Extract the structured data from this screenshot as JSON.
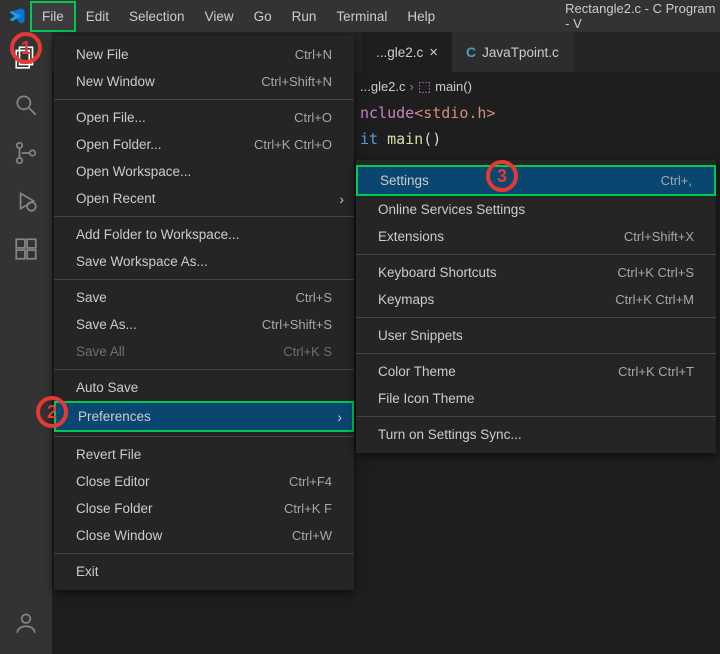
{
  "window_title": "Rectangle2.c - C Program - V",
  "menubar": [
    "File",
    "Edit",
    "Selection",
    "View",
    "Go",
    "Run",
    "Terminal",
    "Help"
  ],
  "activity_icons": [
    "files-icon",
    "search-icon",
    "source-control-icon",
    "run-debug-icon",
    "extensions-icon",
    "account-icon"
  ],
  "tabs": [
    {
      "name": "...gle2.c",
      "active": true,
      "closable": true
    },
    {
      "name": "JavaTpoint.c",
      "active": false,
      "closable": false
    }
  ],
  "breadcrumb": {
    "file": "...gle2.c",
    "symbol": "main()"
  },
  "code": {
    "line1_a": "nclude",
    "line1_b": "<stdio.h>",
    "line2_a": "it ",
    "line2_b": "main",
    "line2_c": "()"
  },
  "file_menu": [
    {
      "label": "New File",
      "shortcut": "Ctrl+N"
    },
    {
      "label": "New Window",
      "shortcut": "Ctrl+Shift+N"
    },
    {
      "sep": true
    },
    {
      "label": "Open File...",
      "shortcut": "Ctrl+O"
    },
    {
      "label": "Open Folder...",
      "shortcut": "Ctrl+K Ctrl+O"
    },
    {
      "label": "Open Workspace..."
    },
    {
      "label": "Open Recent",
      "submenu": true
    },
    {
      "sep": true
    },
    {
      "label": "Add Folder to Workspace..."
    },
    {
      "label": "Save Workspace As..."
    },
    {
      "sep": true
    },
    {
      "label": "Save",
      "shortcut": "Ctrl+S"
    },
    {
      "label": "Save As...",
      "shortcut": "Ctrl+Shift+S"
    },
    {
      "label": "Save All",
      "shortcut": "Ctrl+K S",
      "disabled": true
    },
    {
      "sep": true
    },
    {
      "label": "Auto Save"
    },
    {
      "label": "Preferences",
      "submenu": true,
      "highlight": true,
      "outline": true
    },
    {
      "sep": true
    },
    {
      "label": "Revert File"
    },
    {
      "label": "Close Editor",
      "shortcut": "Ctrl+F4"
    },
    {
      "label": "Close Folder",
      "shortcut": "Ctrl+K F"
    },
    {
      "label": "Close Window",
      "shortcut": "Ctrl+W"
    },
    {
      "sep": true
    },
    {
      "label": "Exit"
    }
  ],
  "prefs_submenu": [
    {
      "label": "Settings",
      "shortcut": "Ctrl+,",
      "highlight": true,
      "outline": true
    },
    {
      "label": "Online Services Settings"
    },
    {
      "label": "Extensions",
      "shortcut": "Ctrl+Shift+X"
    },
    {
      "sep": true
    },
    {
      "label": "Keyboard Shortcuts",
      "shortcut": "Ctrl+K Ctrl+S"
    },
    {
      "label": "Keymaps",
      "shortcut": "Ctrl+K Ctrl+M"
    },
    {
      "sep": true
    },
    {
      "label": "User Snippets"
    },
    {
      "sep": true
    },
    {
      "label": "Color Theme",
      "shortcut": "Ctrl+K Ctrl+T"
    },
    {
      "label": "File Icon Theme"
    },
    {
      "sep": true
    },
    {
      "label": "Turn on Settings Sync..."
    }
  ],
  "annotations": {
    "a1": "1",
    "a2": "2",
    "a3": "3"
  }
}
